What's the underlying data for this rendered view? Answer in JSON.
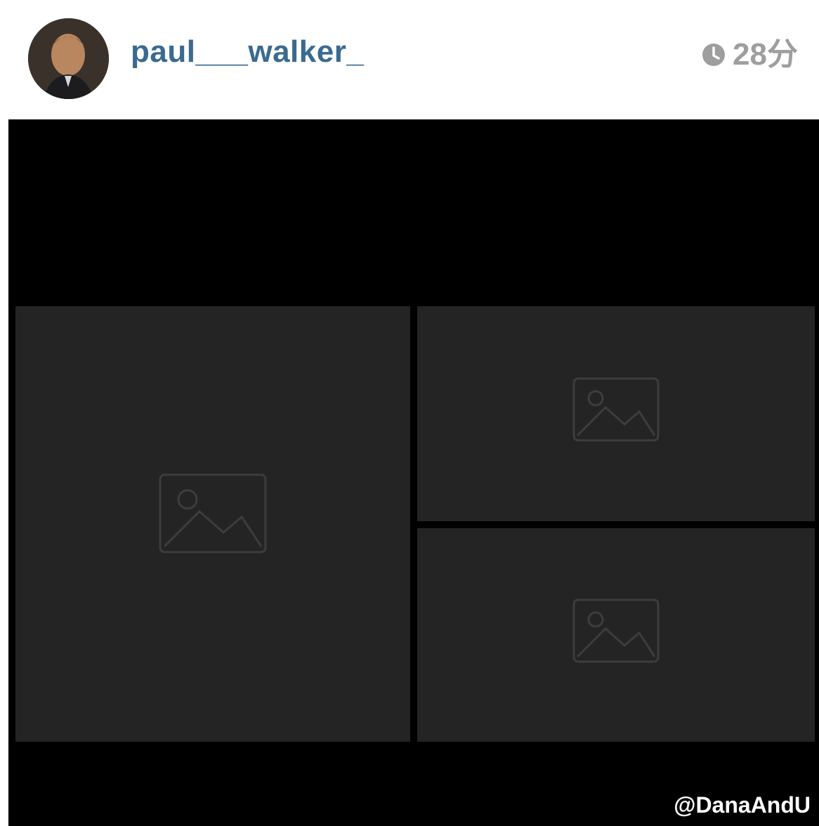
{
  "post": {
    "author": {
      "username": "paul___walker_",
      "avatar_icon": "profile-avatar"
    },
    "timestamp": {
      "icon": "clock-icon",
      "label": "28分"
    },
    "watermark": "@DanaAndU"
  },
  "colors": {
    "username": "#3a6a8f",
    "timestamp": "#9e9e9e",
    "post_background": "#000000",
    "watermark": "#ffffff"
  }
}
